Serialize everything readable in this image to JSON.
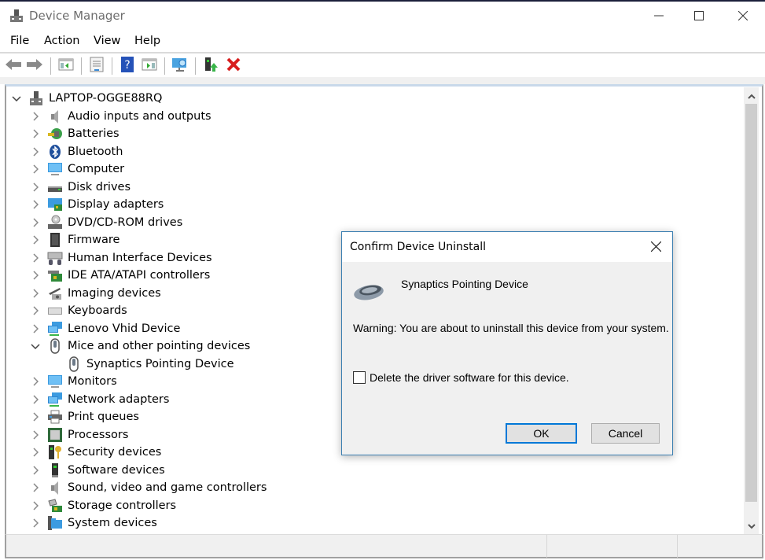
{
  "window": {
    "title": "Device Manager",
    "app_icon": "device-manager-icon",
    "controls": {
      "minimize": "minimize-icon",
      "maximize": "maximize-icon",
      "close": "close-icon"
    }
  },
  "menubar": {
    "items": [
      {
        "label": "File"
      },
      {
        "label": "Action"
      },
      {
        "label": "View"
      },
      {
        "label": "Help"
      }
    ]
  },
  "toolbar": {
    "buttons": [
      {
        "icon": "back-arrow-icon",
        "tooltip": "Back"
      },
      {
        "icon": "forward-arrow-icon",
        "tooltip": "Forward"
      },
      {
        "icon": "show-hide-console-tree-icon"
      },
      {
        "icon": "properties-icon"
      },
      {
        "icon": "help-icon"
      },
      {
        "icon": "show-action-pane-icon"
      },
      {
        "icon": "scan-hardware-changes-icon"
      },
      {
        "icon": "update-driver-icon"
      },
      {
        "icon": "uninstall-device-icon"
      }
    ]
  },
  "tree": {
    "root": {
      "label": "LAPTOP-OGGE88RQ",
      "expanded": true,
      "icon": "computer-tower-icon"
    },
    "categories": [
      {
        "label": "Audio inputs and outputs",
        "icon": "speaker-icon",
        "expanded": false
      },
      {
        "label": "Batteries",
        "icon": "battery-icon",
        "expanded": false
      },
      {
        "label": "Bluetooth",
        "icon": "bluetooth-icon",
        "expanded": false
      },
      {
        "label": "Computer",
        "icon": "monitor-icon",
        "expanded": false
      },
      {
        "label": "Disk drives",
        "icon": "disk-drive-icon",
        "expanded": false
      },
      {
        "label": "Display adapters",
        "icon": "display-adapter-icon",
        "expanded": false
      },
      {
        "label": "DVD/CD-ROM drives",
        "icon": "dvd-drive-icon",
        "expanded": false
      },
      {
        "label": "Firmware",
        "icon": "firmware-chip-icon",
        "expanded": false
      },
      {
        "label": "Human Interface Devices",
        "icon": "hid-icon",
        "expanded": false
      },
      {
        "label": "IDE ATA/ATAPI controllers",
        "icon": "ide-controller-icon",
        "expanded": false
      },
      {
        "label": "Imaging devices",
        "icon": "camera-icon",
        "expanded": false
      },
      {
        "label": "Keyboards",
        "icon": "keyboard-icon",
        "expanded": false
      },
      {
        "label": "Lenovo Vhid Device",
        "icon": "network-monitor-icon",
        "expanded": false
      },
      {
        "label": "Mice and other pointing devices",
        "icon": "mouse-icon",
        "expanded": true,
        "children": [
          {
            "label": "Synaptics Pointing Device",
            "icon": "mouse-icon"
          }
        ]
      },
      {
        "label": "Monitors",
        "icon": "monitor-icon",
        "expanded": false
      },
      {
        "label": "Network adapters",
        "icon": "network-adapter-icon",
        "expanded": false
      },
      {
        "label": "Print queues",
        "icon": "printer-icon",
        "expanded": false
      },
      {
        "label": "Processors",
        "icon": "processor-icon",
        "expanded": false
      },
      {
        "label": "Security devices",
        "icon": "security-key-icon",
        "expanded": false
      },
      {
        "label": "Software devices",
        "icon": "software-device-icon",
        "expanded": false
      },
      {
        "label": "Sound, video and game controllers",
        "icon": "speaker-icon",
        "expanded": false
      },
      {
        "label": "Storage controllers",
        "icon": "storage-controller-icon",
        "expanded": false
      },
      {
        "label": "System devices",
        "icon": "system-devices-icon",
        "expanded": false
      }
    ]
  },
  "dialog": {
    "title": "Confirm Device Uninstall",
    "device_name": "Synaptics Pointing Device",
    "warning": "Warning: You are about to uninstall this device from your system.",
    "checkbox_label": "Delete the driver software for this device.",
    "checkbox_checked": false,
    "ok_label": "OK",
    "cancel_label": "Cancel"
  },
  "colors": {
    "dialog_border": "#3c7fb1",
    "default_button_border": "#0078d7",
    "uninstall_red": "#d81e1e"
  }
}
